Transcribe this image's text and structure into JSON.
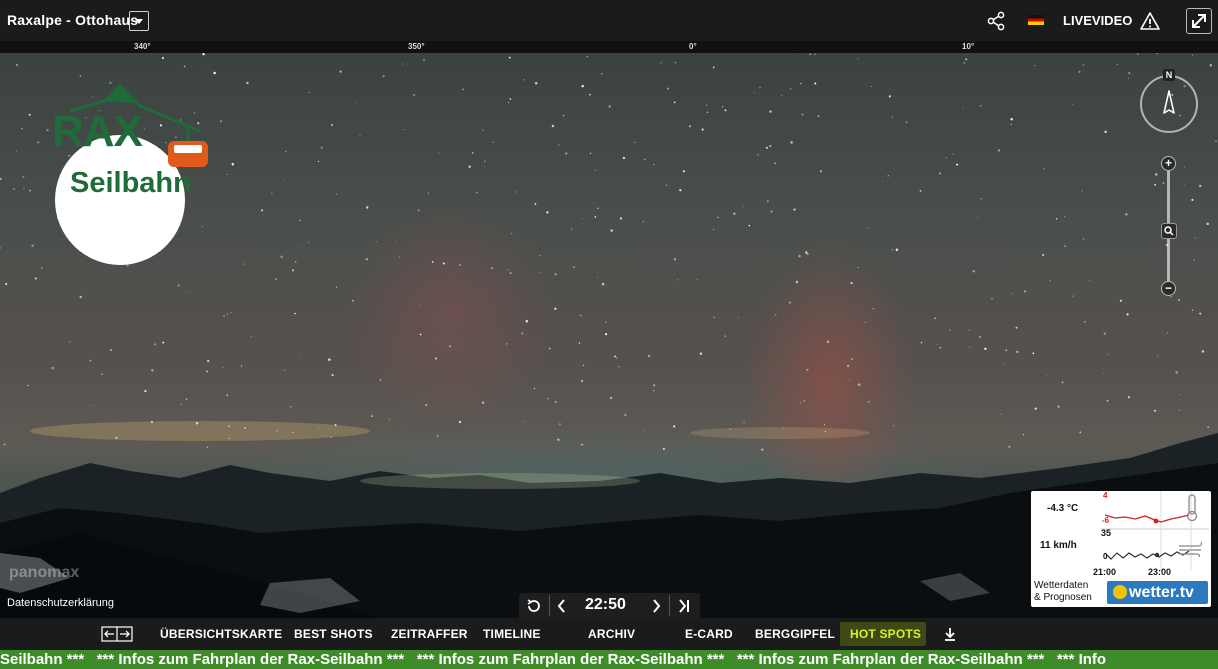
{
  "header": {
    "location_title": "Raxalpe - Ottohaus",
    "livevideo_label": "LIVEVIDEO",
    "share_icon": "share-icon",
    "warning_icon": "warning-icon",
    "language_flag": "flag-de-icon"
  },
  "compass_strip": {
    "degrees": [
      "340°",
      "350°",
      "0°",
      "10°"
    ]
  },
  "logo": {
    "line1": "RAX",
    "line2": "Seilbahn"
  },
  "compass": {
    "north_label": "N"
  },
  "zoom": {
    "plus": "+",
    "minus": "−"
  },
  "weather": {
    "temperature": "-4.3 °C",
    "wind": "11 km/h",
    "temp_axis": [
      "4",
      "-6"
    ],
    "wind_axis": [
      "35",
      "0"
    ],
    "times": [
      "21:00",
      "23:00"
    ],
    "credit_line1": "Wetterdaten",
    "credit_line2": "& Prognosen",
    "brand": "wetter.tv"
  },
  "privacy_link": "Datenschutzerklärung",
  "panomax_logo": "panomax",
  "time_controls": {
    "current_time": "22:50"
  },
  "nav": {
    "items": [
      "ÜBERSICHTSKARTE",
      "BEST SHOTS",
      "ZEITRAFFER",
      "TIMELINE",
      "ARCHIV",
      "E-CARD",
      "BERGGIPFEL",
      "HOT SPOTS"
    ]
  },
  "ticker": {
    "text": "Seilbahn ***   *** Infos zum Fahrplan der Rax-Seilbahn ***   *** Infos zum Fahrplan der Rax-Seilbahn ***   *** Infos zum Fahrplan der Rax-Seilbahn ***   *** Info"
  },
  "colors": {
    "accent_hot": "#d8ef2a",
    "ticker_bg": "#3e8b2a",
    "logo_green": "#1f6b3a",
    "logo_orange": "#e05a1c",
    "weather_brand": "#2d79c0"
  }
}
